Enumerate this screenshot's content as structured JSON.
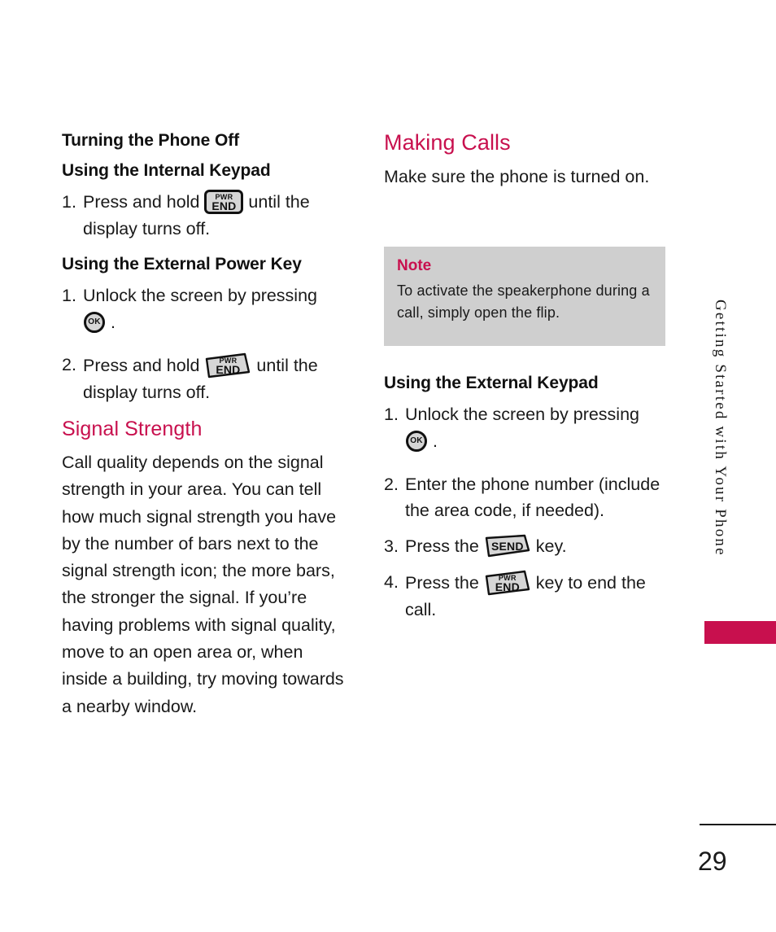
{
  "page": {
    "number": "29",
    "side_tab_label": "Getting Started with Your Phone",
    "accent_color": "#C8104E",
    "note_bg_color": "#CFCFCF"
  },
  "left_column": {
    "section_title": "Turning the Phone Off",
    "subsection_internal": "Using the Internal Keypad",
    "step_internal": {
      "number": "1.",
      "text_before": "Press and hold",
      "key": "PWR END",
      "text_after": "until the display turns off."
    },
    "subsection_external": "Using the External Power Key",
    "steps_external": [
      {
        "number": "1.",
        "text_before": "Unlock the screen by pressing",
        "key": "OK",
        "text_after": "."
      },
      {
        "number": "2.",
        "text_before": "Press and hold",
        "key": "PWR END",
        "text_after": "until the display turns off."
      }
    ],
    "signal_heading": "Signal Strength",
    "signal_body": "Call quality depends on the signal strength in your area. You can tell how much signal strength you have by the number of bars next to the signal strength icon; the more bars, the stronger the signal. If you’re having problems with signal quality, move to an open area or, when inside a building, try moving towards a nearby window."
  },
  "right_column": {
    "section_title": "Making Calls",
    "intro": "Make sure the phone is turned on.",
    "note": {
      "title": "Note",
      "text": "To activate the speakerphone during a call, simply open the flip."
    },
    "subsection_external_keypad": "Using the External Keypad",
    "steps": [
      {
        "number": "1.",
        "text_before": "Unlock the screen by pressing",
        "key": "OK",
        "text_after": "."
      },
      {
        "number": "2.",
        "text_before": "Enter the phone number (include the area code, if needed).",
        "key": "",
        "text_after": ""
      },
      {
        "number": "3.",
        "text_before": "Press the",
        "key": "SEND",
        "text_after": "key."
      },
      {
        "number": "4.",
        "text_before": "Press the",
        "key": "PWR END",
        "text_after": "key to end the call."
      }
    ]
  },
  "key_glyph_labels": {
    "pwr": "PWR",
    "end": "END",
    "send": "SEND",
    "ok": "OK"
  }
}
